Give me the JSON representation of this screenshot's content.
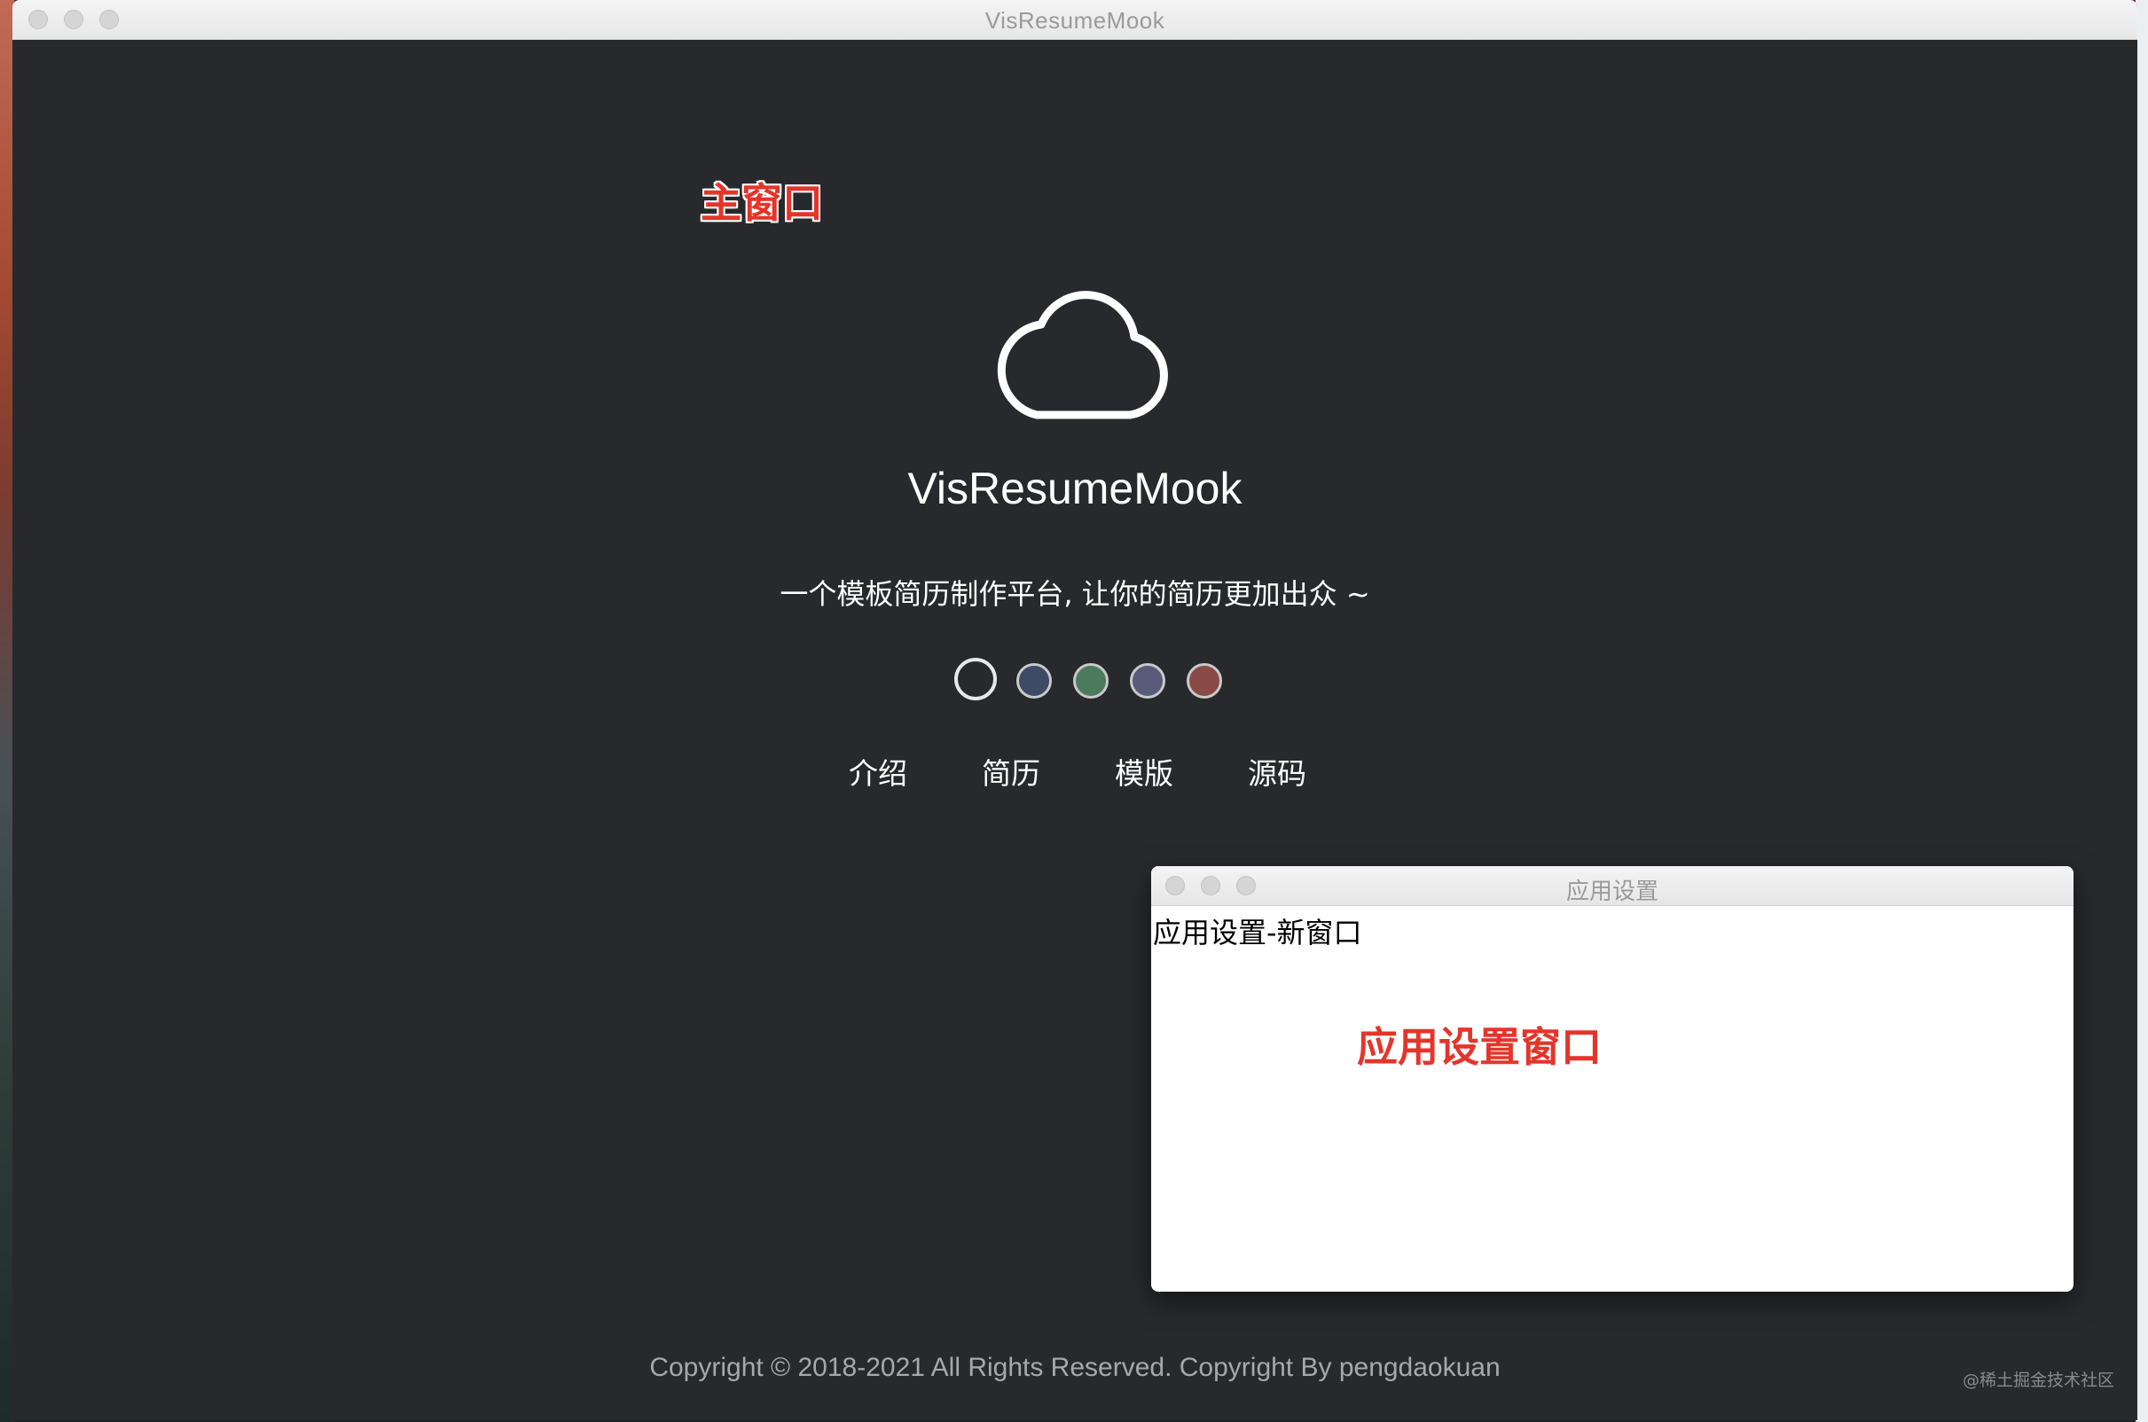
{
  "main_window": {
    "title": "VisResumeMook",
    "annotation": "主窗口",
    "logo_icon": "cloud-icon",
    "app_name": "VisResumeMook",
    "tagline": "一个模板简历制作平台, 让你的简历更加出众 ~",
    "theme_swatches": [
      {
        "color": "#28292d",
        "border": "#e8e8e8",
        "selected": true
      },
      {
        "color": "#3e4a66",
        "border": "#c9c9c9",
        "selected": false
      },
      {
        "color": "#4b7a5c",
        "border": "#c9c9c9",
        "selected": false
      },
      {
        "color": "#5a5a7a",
        "border": "#c9c9c9",
        "selected": false
      },
      {
        "color": "#8a4a47",
        "border": "#c9c9c9",
        "selected": false
      }
    ],
    "nav": {
      "intro": "介绍",
      "resume": "简历",
      "template": "模版",
      "source": "源码"
    },
    "footer": "Copyright © 2018-2021 All Rights Reserved. Copyright By pengdaokuan"
  },
  "settings_window": {
    "title": "应用设置",
    "body_text": "应用设置-新窗口",
    "annotation": "应用设置窗口"
  },
  "watermark": "@稀土掘金技术社区"
}
